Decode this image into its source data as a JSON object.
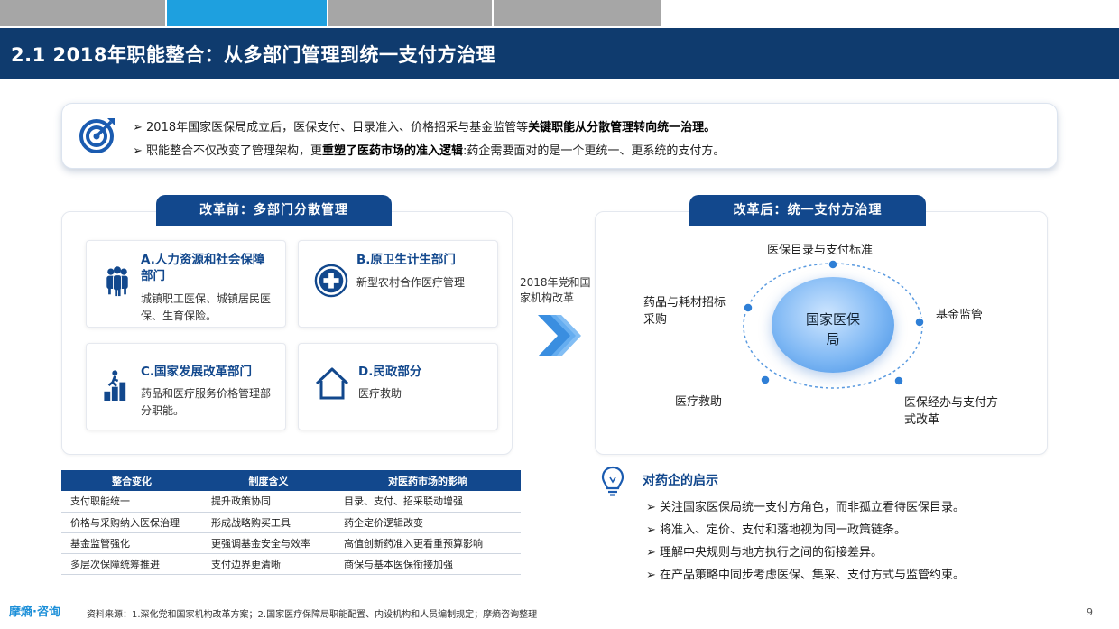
{
  "title": "2.1  2018年职能整合：从多部门管理到统一支付方治理",
  "intro": {
    "line1_pre": "➢ 2018年国家医保局成立后，医保支付、目录准入、价格招采与基金监管等",
    "line1_bold": "关键职能从分散管理转向统一治理。",
    "line2_pre": "➢ 职能整合不仅改变了管理架构，更",
    "line2_bold": "重塑了医药市场的准入逻辑",
    "line2_post": ":药企需要面对的是一个更统一、更系统的支付方。"
  },
  "before": {
    "label": "改革前：多部门分散管理",
    "cards": [
      {
        "title": "A.人力资源和社会保障部门",
        "desc": "城镇职工医保、城镇居民医保、生育保险。",
        "icon": "people-group-icon"
      },
      {
        "title": "B.原卫生计生部门",
        "desc": "新型农村合作医疗管理",
        "icon": "medical-cross-icon"
      },
      {
        "title": "C.国家发展改革部门",
        "desc": "药品和医疗服务价格管理部分职能。",
        "icon": "climbing-stairs-icon"
      },
      {
        "title": "D.民政部分",
        "desc": "医疗救助",
        "icon": "house-icon"
      }
    ]
  },
  "reform_note": "2018年党和国家机构改革",
  "after": {
    "label": "改革后：统一支付方治理",
    "center": "国家医保局",
    "orbit": {
      "top": "医保目录与支付标准",
      "right": "基金监管",
      "bottom_right": "医保经办与支付方式改革",
      "bottom_left": "医疗救助",
      "left": "药品与耗材招标采购"
    }
  },
  "table": {
    "headers": [
      "整合变化",
      "制度含义",
      "对医药市场的影响"
    ],
    "rows": [
      [
        "支付职能统一",
        "提升政策协同",
        "目录、支付、招采联动增强"
      ],
      [
        "价格与采购纳入医保治理",
        "形成战略购买工具",
        "药企定价逻辑改变"
      ],
      [
        "基金监管强化",
        "更强调基金安全与效率",
        "高值创新药准入更看重预算影响"
      ],
      [
        "多层次保障统筹推进",
        "支付边界更清晰",
        "商保与基本医保衔接加强"
      ]
    ]
  },
  "insights": {
    "title": "对药企的启示",
    "items": [
      "➢ 关注国家医保局统一支付方角色，而非孤立看待医保目录。",
      "➢ 将准入、定价、支付和落地视为同一政策链条。",
      "➢ 理解中央规则与地方执行之间的衔接差异。",
      "➢ 在产品策略中同步考虑医保、集采、支付方式与监管约束。"
    ]
  },
  "footer": {
    "logo": "摩熵·咨询",
    "source": "资料来源：1.深化党和国家机构改革方案；2.国家医疗保障局职能配置、内设机构和人员编制规定；摩熵咨询整理",
    "page": "9"
  },
  "colors": {
    "navy": "#0f3b6e",
    "blue": "#12488d",
    "accent": "#1ea0df"
  }
}
